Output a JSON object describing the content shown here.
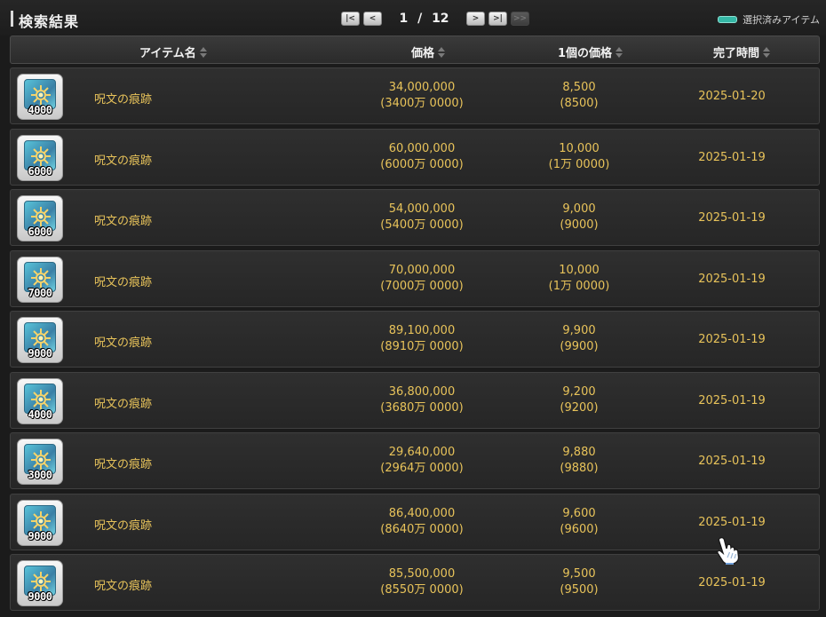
{
  "title": "検索結果",
  "pager": {
    "first": "|<",
    "prev": "<",
    "current": "1",
    "separator": "/",
    "total": "12",
    "next": ">",
    "last": ">|",
    "extra": ">>"
  },
  "legend": {
    "label": "選択済みアイテム",
    "color": "#35b8a6"
  },
  "columns": {
    "name": "アイテム名",
    "price": "価格",
    "unit_price": "1個の価格",
    "end_time": "完了時間"
  },
  "rows": [
    {
      "qty": "4000",
      "name": "呪文の痕跡",
      "price": "34,000,000",
      "price_sub": "(3400万 0000)",
      "unit": "8,500",
      "unit_sub": "(8500)",
      "date": "2025-01-20"
    },
    {
      "qty": "6000",
      "name": "呪文の痕跡",
      "price": "60,000,000",
      "price_sub": "(6000万 0000)",
      "unit": "10,000",
      "unit_sub": "(1万 0000)",
      "date": "2025-01-19"
    },
    {
      "qty": "6000",
      "name": "呪文の痕跡",
      "price": "54,000,000",
      "price_sub": "(5400万 0000)",
      "unit": "9,000",
      "unit_sub": "(9000)",
      "date": "2025-01-19"
    },
    {
      "qty": "7000",
      "name": "呪文の痕跡",
      "price": "70,000,000",
      "price_sub": "(7000万 0000)",
      "unit": "10,000",
      "unit_sub": "(1万 0000)",
      "date": "2025-01-19"
    },
    {
      "qty": "9000",
      "name": "呪文の痕跡",
      "price": "89,100,000",
      "price_sub": "(8910万 0000)",
      "unit": "9,900",
      "unit_sub": "(9900)",
      "date": "2025-01-19"
    },
    {
      "qty": "4000",
      "name": "呪文の痕跡",
      "price": "36,800,000",
      "price_sub": "(3680万 0000)",
      "unit": "9,200",
      "unit_sub": "(9200)",
      "date": "2025-01-19"
    },
    {
      "qty": "3000",
      "name": "呪文の痕跡",
      "price": "29,640,000",
      "price_sub": "(2964万 0000)",
      "unit": "9,880",
      "unit_sub": "(9880)",
      "date": "2025-01-19"
    },
    {
      "qty": "9000",
      "name": "呪文の痕跡",
      "price": "86,400,000",
      "price_sub": "(8640万 0000)",
      "unit": "9,600",
      "unit_sub": "(9600)",
      "date": "2025-01-19"
    },
    {
      "qty": "9000",
      "name": "呪文の痕跡",
      "price": "85,500,000",
      "price_sub": "(8550万 0000)",
      "unit": "9,500",
      "unit_sub": "(9500)",
      "date": "2025-01-19"
    }
  ]
}
